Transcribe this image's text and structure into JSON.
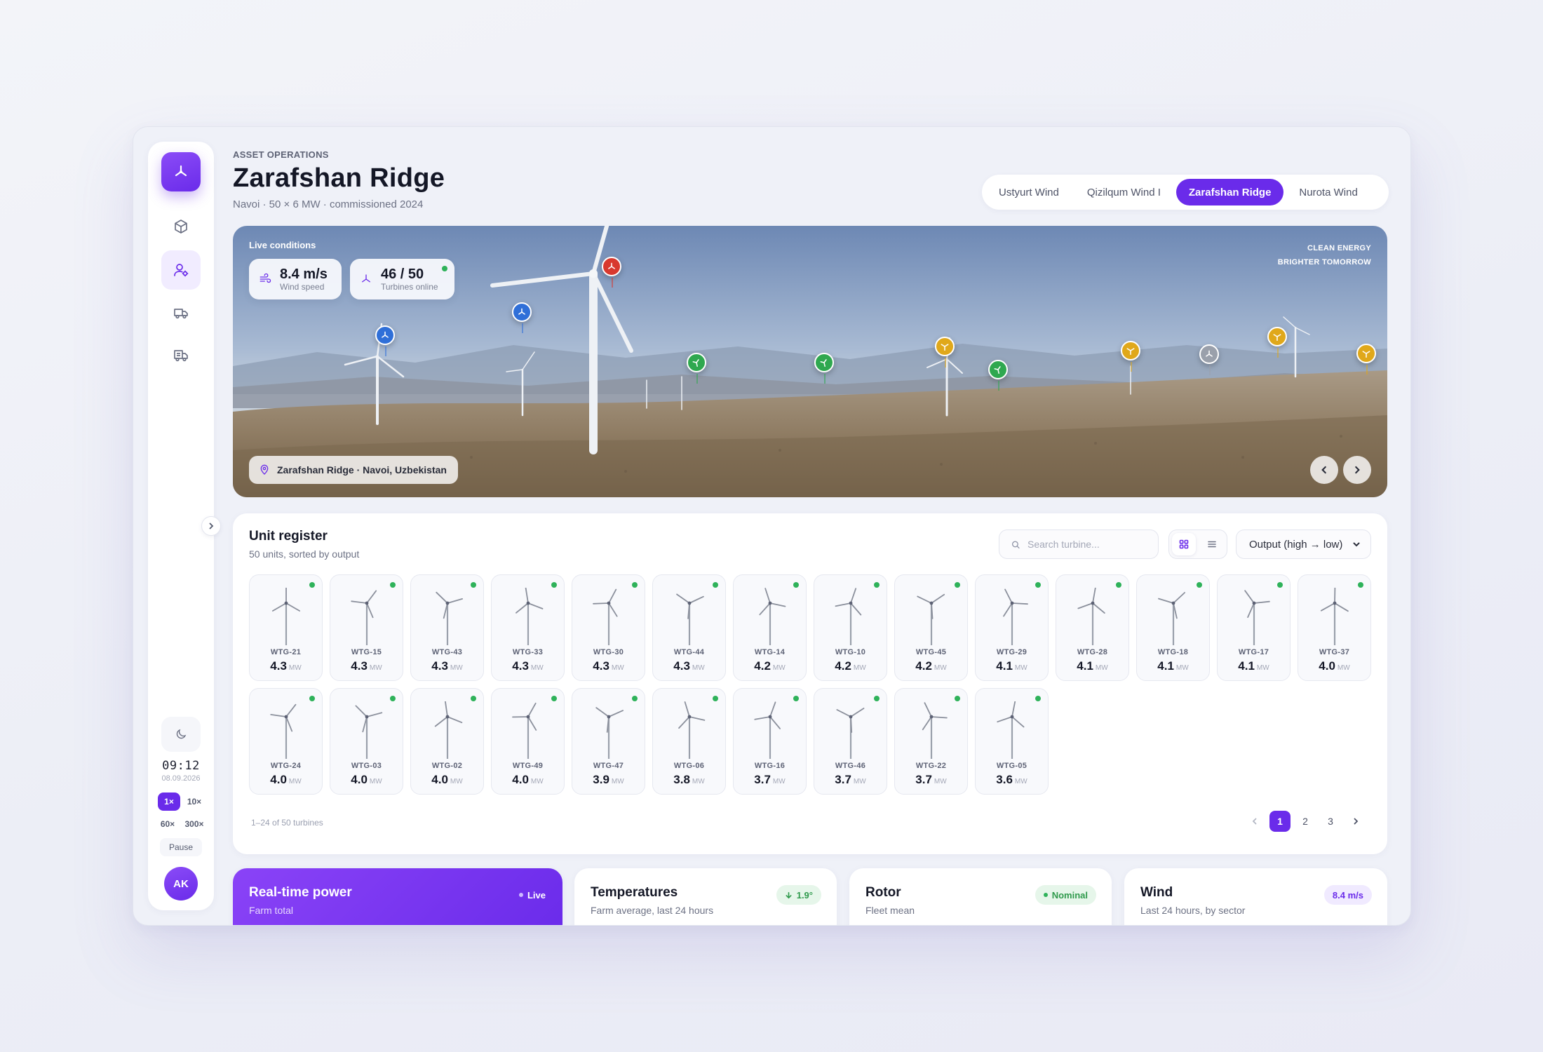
{
  "sidebar": {
    "items": [
      {
        "name": "assets",
        "icon": "cube-icon"
      },
      {
        "name": "operators",
        "icon": "user-gear-icon",
        "active": true
      },
      {
        "name": "transport",
        "icon": "truck-icon"
      },
      {
        "name": "logistics",
        "icon": "truck-box-icon"
      }
    ],
    "clock": "09:12",
    "date": "08.09.2026",
    "speeds": [
      "1×",
      "10×",
      "60×",
      "300×"
    ],
    "selected_speed": "1×",
    "pause_label": "Pause",
    "avatar_initials": "AK"
  },
  "header": {
    "eyebrow": "ASSET OPERATIONS",
    "title": "Zarafshan Ridge",
    "subtitle": "Navoi · 50 × 6 MW · commissioned 2024"
  },
  "site_tabs": [
    {
      "label": "Ustyurt Wind",
      "active": false
    },
    {
      "label": "Qizilqum Wind I",
      "active": false
    },
    {
      "label": "Zarafshan Ridge",
      "active": true
    },
    {
      "label": "Nurota Wind",
      "active": false
    }
  ],
  "hero": {
    "live_label": "Live conditions",
    "wind_speed": {
      "value": "8.4 m/s",
      "label": "Wind speed"
    },
    "turbines_online": {
      "value": "46 / 50",
      "label": "Turbines online"
    },
    "tagline": [
      "CLEAN ENERGY",
      "BRIGHTER TOMORROW"
    ],
    "location": "Zarafshan Ridge · Navoi, Uzbekistan",
    "pin_colors": {
      "blue": "#2f6fd8",
      "red": "#d8392f",
      "green": "#2fa84f",
      "yellow": "#e0a81a",
      "grey": "#9aa0ab"
    }
  },
  "register": {
    "title": "Unit register",
    "subtitle": "50 units, sorted by output",
    "search_placeholder": "Search turbine...",
    "sort_label": "Output (high → low)",
    "unit_label": "MW",
    "count_text": "1–24 of 50 turbines",
    "pages": [
      "1",
      "2",
      "3"
    ],
    "current_page": "1",
    "turbines": [
      {
        "id": "WTG-21",
        "output": "4.3"
      },
      {
        "id": "WTG-15",
        "output": "4.3"
      },
      {
        "id": "WTG-43",
        "output": "4.3"
      },
      {
        "id": "WTG-33",
        "output": "4.3"
      },
      {
        "id": "WTG-30",
        "output": "4.3"
      },
      {
        "id": "WTG-44",
        "output": "4.3"
      },
      {
        "id": "WTG-14",
        "output": "4.2"
      },
      {
        "id": "WTG-10",
        "output": "4.2"
      },
      {
        "id": "WTG-45",
        "output": "4.2"
      },
      {
        "id": "WTG-29",
        "output": "4.1"
      },
      {
        "id": "WTG-28",
        "output": "4.1"
      },
      {
        "id": "WTG-18",
        "output": "4.1"
      },
      {
        "id": "WTG-17",
        "output": "4.1"
      },
      {
        "id": "WTG-37",
        "output": "4.0"
      },
      {
        "id": "WTG-24",
        "output": "4.0"
      },
      {
        "id": "WTG-03",
        "output": "4.0"
      },
      {
        "id": "WTG-02",
        "output": "4.0"
      },
      {
        "id": "WTG-49",
        "output": "4.0"
      },
      {
        "id": "WTG-47",
        "output": "3.9"
      },
      {
        "id": "WTG-06",
        "output": "3.8"
      },
      {
        "id": "WTG-16",
        "output": "3.7"
      },
      {
        "id": "WTG-46",
        "output": "3.7"
      },
      {
        "id": "WTG-22",
        "output": "3.7"
      },
      {
        "id": "WTG-05",
        "output": "3.6"
      }
    ]
  },
  "bottom_cards": {
    "power": {
      "title": "Real-time power",
      "subtitle": "Farm total",
      "badge": "Live"
    },
    "temperatures": {
      "title": "Temperatures",
      "subtitle": "Farm average, last 24 hours",
      "badge": "1.9°"
    },
    "rotor": {
      "title": "Rotor",
      "subtitle": "Fleet mean",
      "badge": "Nominal"
    },
    "wind": {
      "title": "Wind",
      "subtitle": "Last 24 hours, by sector",
      "badge": "8.4 m/s"
    }
  },
  "colors": {
    "accent": "#6a2bea",
    "online": "#2fb25a"
  }
}
